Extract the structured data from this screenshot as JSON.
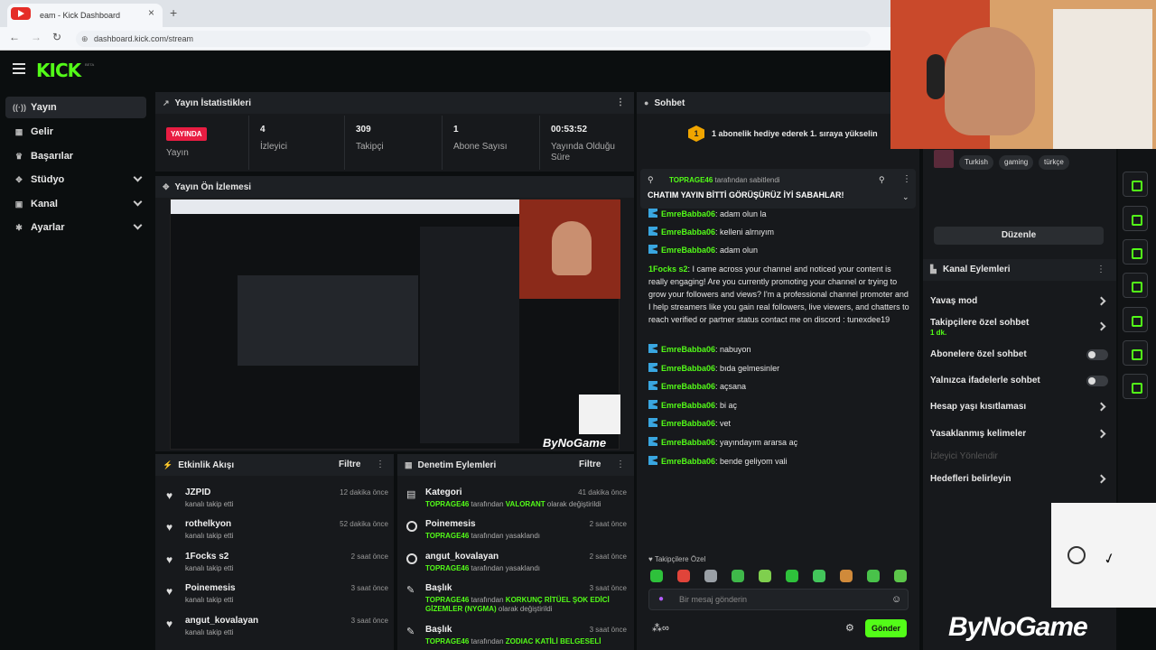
{
  "browser": {
    "tab_title": "eam - Kick Dashboard",
    "tab_close": "×",
    "new_tab": "+",
    "url": "dashboard.kick.com/stream",
    "back": "←",
    "forward": "→",
    "reload": "↻"
  },
  "logo": {
    "text": "KICK",
    "beta": "BETA"
  },
  "sidebar": {
    "items": [
      {
        "label": "Yayın",
        "icon": "broadcast-icon",
        "glyph": "((·))"
      },
      {
        "label": "Gelir",
        "icon": "revenue-icon",
        "glyph": "▦"
      },
      {
        "label": "Başarılar",
        "icon": "trophy-icon",
        "glyph": "♛"
      },
      {
        "label": "Stüdyo",
        "icon": "studio-icon",
        "glyph": "✥"
      },
      {
        "label": "Kanal",
        "icon": "channel-icon",
        "glyph": "▣"
      },
      {
        "label": "Ayarlar",
        "icon": "settings-icon",
        "glyph": "✱"
      }
    ]
  },
  "stats": {
    "title": "Yayın İstatistikleri",
    "live_badge": "YAYINDA",
    "live_label": "Yayın",
    "viewers_value": "4",
    "viewers_label": "İzleyici",
    "followers_value": "309",
    "followers_label": "Takipçi",
    "subs_value": "1",
    "subs_label": "Abone Sayısı",
    "duration_value": "00:53:52",
    "duration_label": "Yayında Olduğu Süre"
  },
  "preview": {
    "title": "Yayın Ön İzlemesi",
    "watermark": "ByNoGame"
  },
  "activity": {
    "title": "Etkinlik Akışı",
    "filter": "Filtre",
    "rows": [
      {
        "name": "JZPID",
        "sub": "kanalı takip etti",
        "time": "12 dakika önce"
      },
      {
        "name": "rothelkyon",
        "sub": "kanalı takip etti",
        "time": "52 dakika önce"
      },
      {
        "name": "1Focks s2",
        "sub": "kanalı takip etti",
        "time": "2 saat önce"
      },
      {
        "name": "Poinemesis",
        "sub": "kanalı takip etti",
        "time": "3 saat önce"
      },
      {
        "name": "angut_kovalayan",
        "sub": "kanalı takip etti",
        "time": "3 saat önce"
      }
    ]
  },
  "moderation": {
    "title": "Denetim Eylemleri",
    "filter": "Filtre",
    "rows": [
      {
        "name": "Kategori",
        "actor": "TOPRAGE46",
        "text": " tarafından ",
        "hl": "VALORANT",
        "tail": " olarak değiştirildi",
        "time": "41 dakika önce"
      },
      {
        "name": "Poinemesis",
        "actor": "TOPRAGE46",
        "text": " tarafından yasaklandı",
        "hl": "",
        "tail": "",
        "time": "2 saat önce"
      },
      {
        "name": "angut_kovalayan",
        "actor": "TOPRAGE46",
        "text": " tarafından yasaklandı",
        "hl": "",
        "tail": "",
        "time": "2 saat önce"
      },
      {
        "name": "Başlık",
        "actor": "TOPRAGE46",
        "text": " tarafından ",
        "hl": "KORKUNÇ RİTÜEL ŞOK EDİCİ",
        "tail": "",
        "line2_hl": "GİZEMLER (NYGMA)",
        "line2_tail": " olarak değiştirildi",
        "time": "3 saat önce"
      },
      {
        "name": "Başlık",
        "actor": "TOPRAGE46",
        "text": " tarafından ",
        "hl": "ZODIAC KATİLİ BELGESELİ",
        "tail": "",
        "time": "3 saat önce"
      }
    ]
  },
  "chat": {
    "title": "Sohbet",
    "goal_number": "1",
    "goal_text": "1 abonelik hediye ederek 1. sıraya yükselin",
    "pinned_user": "TOPRAGE46",
    "pinned_suffix": " tarafından sabitlendi",
    "pinned_message": "CHATIM YAYIN BİTTİ GÖRÜŞÜRÜZ İYİ SABAHLAR!",
    "messages": [
      {
        "user": "EmreBabba06",
        "text": ": adam olun la"
      },
      {
        "user": "EmreBabba06",
        "text": ": kelleni alrnıyım"
      },
      {
        "user": "EmreBabba06",
        "text": ": adam olun"
      },
      {
        "user": "1Focks s2",
        "text": ": I came across your channel and noticed your content is really engaging! Are you currently promoting your channel or trying to grow your followers and views? I'm a professional channel promoter and I help streamers like you gain real followers, live viewers, and chatters to reach verified or partner status contact me on discord : tunexdee19"
      },
      {
        "user": "EmreBabba06",
        "text": ": nabuyon"
      },
      {
        "user": "EmreBabba06",
        "text": ": bıda gelmesinler"
      },
      {
        "user": "EmreBabba06",
        "text": ": açsana"
      },
      {
        "user": "EmreBabba06",
        "text": ": bi aç"
      },
      {
        "user": "EmreBabba06",
        "text": ": vet"
      },
      {
        "user": "EmreBabba06",
        "text": ": yayındayım ararsa aç"
      },
      {
        "user": "EmreBabba06",
        "text": ": bende geliyom vali"
      }
    ],
    "followers_only": "Takipçilere Özel",
    "input_placeholder": "Bir mesaj gönderin",
    "send": "Gönder",
    "emote_count": 10
  },
  "channel": {
    "tags": [
      "Turkish",
      "gaming",
      "türkçe"
    ],
    "edit": "Düzenle",
    "actions_title": "Kanal Eylemleri",
    "slow_mode": "Yavaş mod",
    "followers_chat": "Takipçilere özel sohbet",
    "followers_chat_sub": "1 dk.",
    "subs_chat": "Abonelere özel sohbet",
    "emote_chat": "Yalnızca ifadelerle sohbet",
    "account_age": "Hesap yaşı kısıtlaması",
    "banned_words": "Yasaklanmış kelimeler",
    "viewer_redirect": "İzleyici Yönlendir",
    "set_goals": "Hedefleri belirleyin"
  },
  "overlay": {
    "brand": "ByNoGame"
  },
  "colors": {
    "accent": "#53fc18",
    "live": "#e91d42",
    "panel": "#17191c"
  }
}
